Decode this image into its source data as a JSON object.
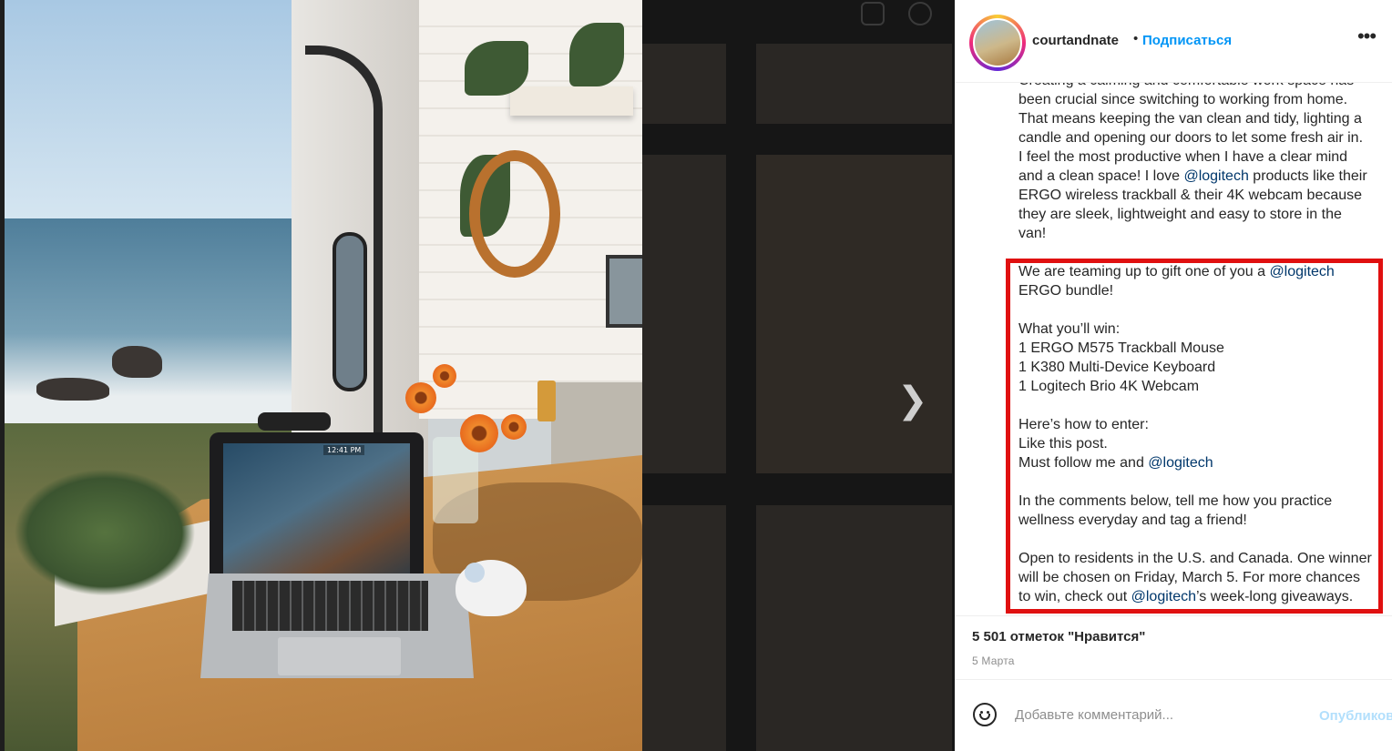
{
  "post": {
    "username": "courtandnate",
    "separator": "•",
    "follow_label": "Подписаться",
    "more_label": "•••",
    "laptop_time": "12:41 PM"
  },
  "caption": {
    "intro_top": "Creating a calming and comfortable work space has",
    "intro_l1": "been crucial since switching to working from home.",
    "intro_l2": "That means keeping the van clean and tidy, lighting a",
    "intro_l3": "candle and opening our doors to let some fresh air in.",
    "intro_l4": "I feel the most productive when I have a clear mind",
    "intro_l5_pre": "and a clean space! I love ",
    "mention": "@logitech",
    "intro_l5_post": " products like their",
    "intro_l6": "ERGO wireless trackball & their 4K webcam because",
    "intro_l7": "they are sleek, lightweight and easy to store in the",
    "intro_l8": "van!",
    "giveaway_l1_pre": "We are teaming up to gift one of you a ",
    "giveaway_l2": "ERGO bundle!",
    "win_heading": "What you’ll win:",
    "win_items": [
      "1 ERGO M575 Trackball Mouse",
      "1 K380 Multi-Device Keyboard",
      "1 Logitech Brio 4K Webcam"
    ],
    "enter_heading": "Here’s how to enter:",
    "enter_l1": "Like this post.",
    "enter_l2_pre": "Must follow me and ",
    "comments_l1": "In the comments below, tell me how you practice",
    "comments_l2": "wellness everyday and tag a friend!",
    "open_l1": "Open to residents in the U.S. and Canada. One winner",
    "open_l2": "will be chosen on Friday, March 5. For more chances",
    "open_l3_pre": "to win, check out ",
    "open_l3_post": "’s week-long giveaways."
  },
  "stats": {
    "likes": "5 501 отметок \"Нравится\"",
    "date": "5 Марта"
  },
  "comment": {
    "placeholder": "Добавьте комментарий...",
    "publish_label": "Опубликовать"
  },
  "nav": {
    "next_arrow": "❯"
  },
  "colors": {
    "highlight": "#e01010",
    "link": "#0095f6",
    "mention": "#00376b"
  }
}
